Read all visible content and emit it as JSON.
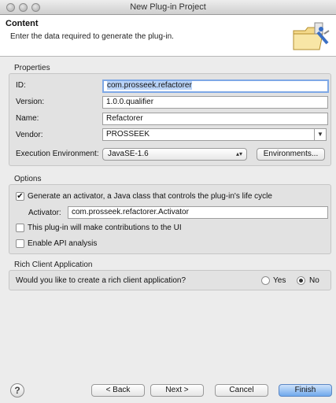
{
  "window": {
    "title": "New Plug-in Project"
  },
  "header": {
    "title": "Content",
    "message": "Enter the data required to generate the plug-in."
  },
  "properties": {
    "group_label": "Properties",
    "id_label": "ID:",
    "id_value": "com.prosseek.refactorer",
    "version_label": "Version:",
    "version_value": "1.0.0.qualifier",
    "name_label": "Name:",
    "name_value": "Refactorer",
    "vendor_label": "Vendor:",
    "vendor_value": "PROSSEEK",
    "env_label": "Execution Environment:",
    "env_value": "JavaSE-1.6",
    "environments_button": "Environments..."
  },
  "options": {
    "group_label": "Options",
    "activator_checkbox_label": "Generate an activator, a Java class that controls the plug-in's life cycle",
    "activator_checked": true,
    "activator_label": "Activator:",
    "activator_value": "com.prosseek.refactorer.Activator",
    "ui_checkbox_label": "This plug-in will make contributions to the UI",
    "ui_checked": false,
    "api_checkbox_label": "Enable API analysis",
    "api_checked": false
  },
  "rca": {
    "group_label": "Rich Client Application",
    "question": "Would you like to create a rich client application?",
    "yes_label": "Yes",
    "no_label": "No",
    "selected": "No"
  },
  "footer": {
    "help_glyph": "?",
    "back_label": "< Back",
    "next_label": "Next >",
    "cancel_label": "Cancel",
    "finish_label": "Finish"
  },
  "colors": {
    "accent": "#6fa9ec",
    "focus": "#7ea8e6"
  }
}
